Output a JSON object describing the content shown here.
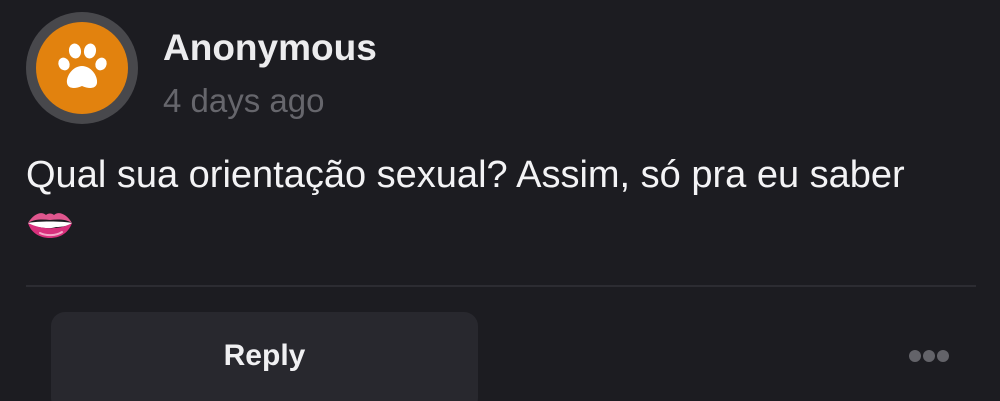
{
  "post": {
    "author": "Anonymous",
    "timestamp": "4 days ago",
    "avatar_icon": "paw-icon",
    "avatar_color": "#e2820e",
    "message": "Qual sua orientação sexual? Assim, só pra eu saber",
    "emoji": "lips-biting-icon"
  },
  "actions": {
    "reply_label": "Reply",
    "more_icon": "more-horizontal-icon"
  }
}
